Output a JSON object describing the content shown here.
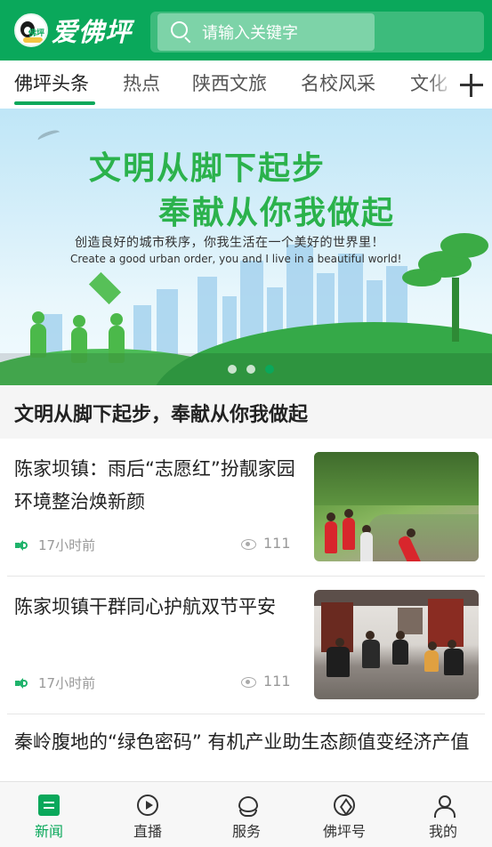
{
  "header": {
    "logo_text": "爱佛坪",
    "logo_badge_text": "佛坪",
    "search_placeholder": "请输入关键字",
    "brand_color": "#0aa85b"
  },
  "tabs": [
    {
      "label": "佛坪头条",
      "active": true
    },
    {
      "label": "热点",
      "active": false
    },
    {
      "label": "陕西文旅",
      "active": false
    },
    {
      "label": "名校风采",
      "active": false
    },
    {
      "label": "文化",
      "active": false
    }
  ],
  "banner": {
    "title_line1": "文明从脚下起步",
    "title_line2": "奉献从你我做起",
    "subtitle": "创造良好的城市秩序，你我生活在一个美好的世界里！",
    "subtitle_en": "Create a good urban order, you and I live in a beautiful world!",
    "slide_count": 3,
    "active_slide": 3,
    "caption": "文明从脚下起步，奉献从你我做起"
  },
  "news": [
    {
      "title": "陈家坝镇：雨后“志愿红”扮靓家园 环境整治焕新颜",
      "time": "17小时前",
      "views": "111",
      "icon": "speaker-icon"
    },
    {
      "title": "陈家坝镇干群同心护航双节平安",
      "time": "17小时前",
      "views": "111",
      "icon": "speaker-icon"
    },
    {
      "title": "秦岭腹地的“绿色密码” 有机产业助生态颜值变经济产值"
    }
  ],
  "bottom_nav": [
    {
      "label": "新闻",
      "icon": "news-icon",
      "active": true
    },
    {
      "label": "直播",
      "icon": "play-circle-icon",
      "active": false
    },
    {
      "label": "服务",
      "icon": "service-heart-icon",
      "active": false
    },
    {
      "label": "佛坪号",
      "icon": "compass-icon",
      "active": false
    },
    {
      "label": "我的",
      "icon": "user-icon",
      "active": false
    }
  ]
}
